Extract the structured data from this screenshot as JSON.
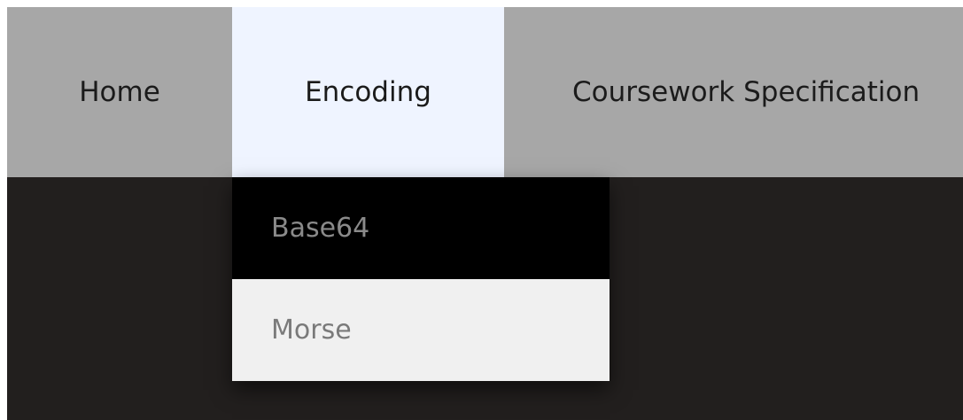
{
  "nav": {
    "items": [
      {
        "label": "Home"
      },
      {
        "label": "Encoding"
      },
      {
        "label": "Coursework Specification"
      }
    ],
    "active_item": "Encoding"
  },
  "dropdown": {
    "items": [
      {
        "label": "Base64"
      },
      {
        "label": "Morse"
      }
    ]
  },
  "colors": {
    "navbar_bg": "#a7a7a7",
    "active_tab_bg": "#eff4ff",
    "page_bg": "#221f1e",
    "dropdown_item_dark": "#000000",
    "dropdown_item_light": "#f0f0f0"
  }
}
